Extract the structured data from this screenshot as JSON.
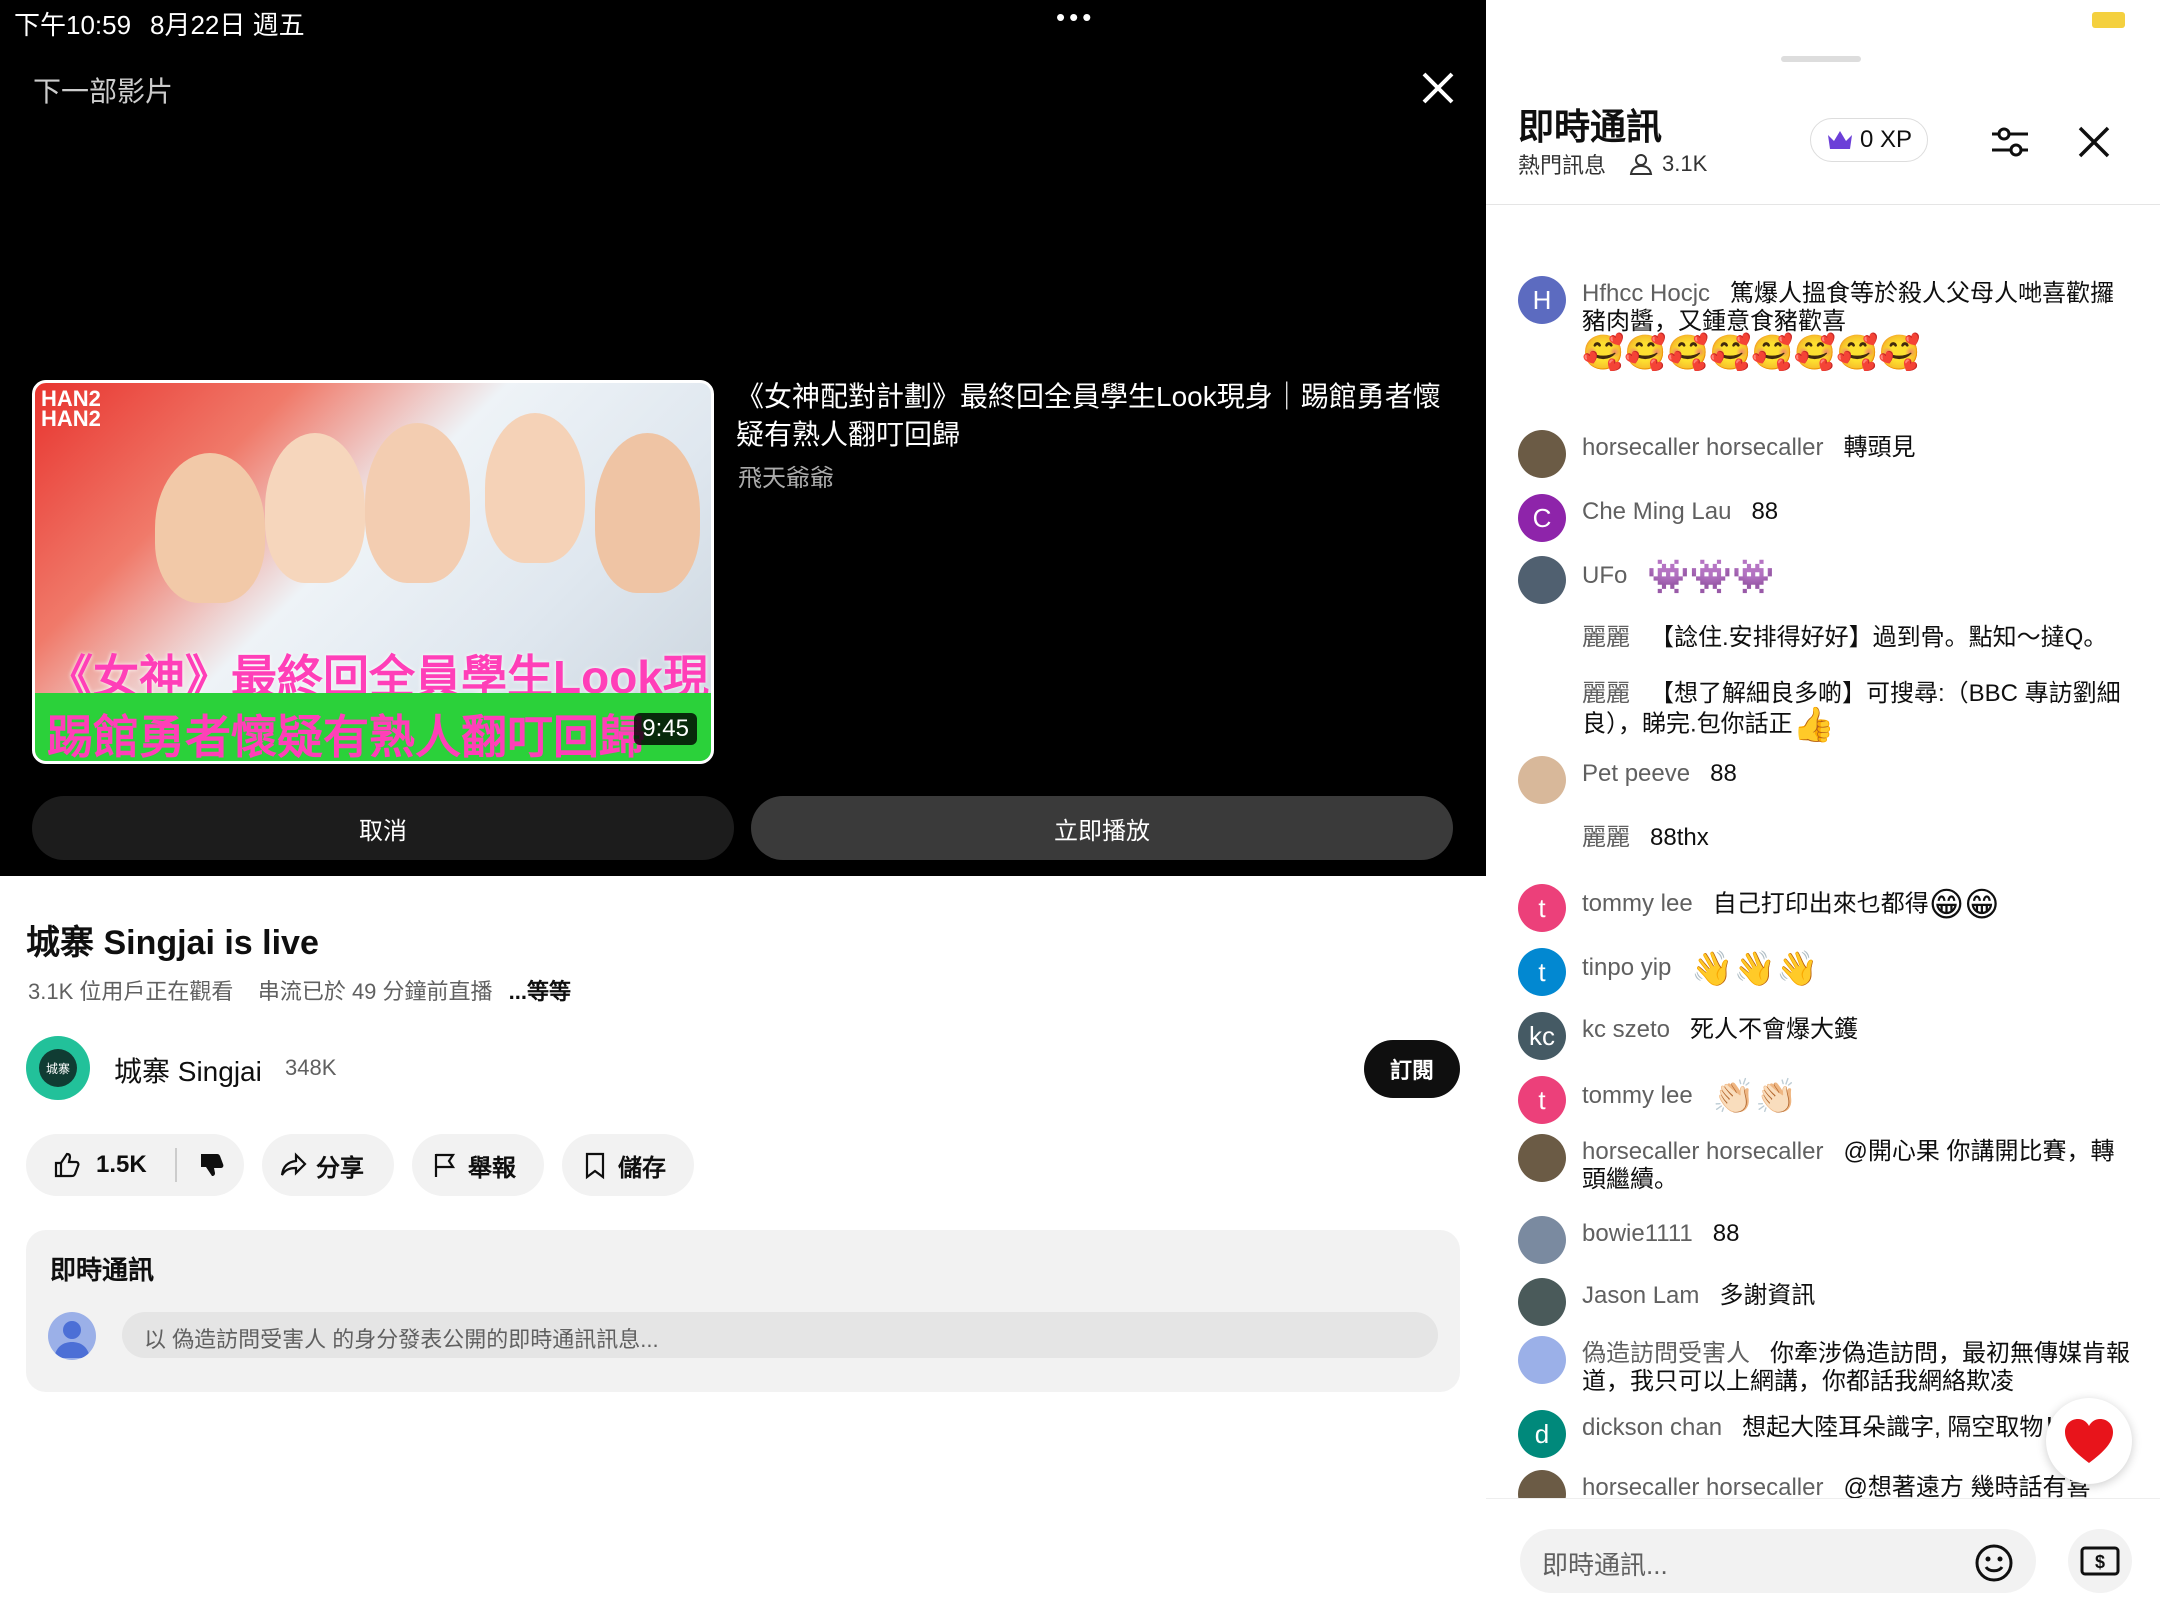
{
  "status": {
    "time": "下午10:59",
    "date": "8月22日 週五",
    "battery": "79%"
  },
  "up_next": {
    "label": "下一部影片",
    "title": "《女神配對計劃》最終回全員學生Look現身｜踢館勇者懷疑有熟人翻叮回歸",
    "channel": "飛天爺爺",
    "duration": "9:45",
    "thumb_line1": "《女神》最終回全員學生Look現身",
    "thumb_line2": "踢館勇者懷疑有熟人翻叮回歸",
    "cancel": "取消",
    "play_now": "立即播放"
  },
  "video": {
    "title": "城寨 Singjai is live",
    "viewers": "3.1K 位用戶正在觀看",
    "started": "串流已於 49 分鐘前直播",
    "more": "...等等",
    "channel_name": "城寨 Singjai",
    "channel_subs": "348K",
    "avatar_text": "城寨",
    "subscribe": "訂閱",
    "likes": "1.5K",
    "share": "分享",
    "report": "舉報",
    "save": "儲存"
  },
  "chat_card": {
    "title": "即時通訊",
    "placeholder": "以 偽造訪問受害人 的身分發表公開的即時通訊訊息..."
  },
  "panel": {
    "title": "即時通訊",
    "mode": "熱門訊息",
    "viewers": "3.1K",
    "xp": "0 XP",
    "input_placeholder": "即時通訊...",
    "messages": [
      {
        "initial": "H",
        "author": "Hfhcc Hocjc",
        "text": "篤爆人搵食等於殺人父母人哋喜歡攞豬肉醬，又鍾意食豬歡喜",
        "emoji": "🥰🥰🥰🥰🥰🥰🥰🥰",
        "color": "#5c6bc0"
      },
      {
        "initial": "",
        "author": "horsecaller horsecaller",
        "text": "轉頭見",
        "emoji": "",
        "color": "#6b5b45"
      },
      {
        "initial": "C",
        "author": "Che Ming Lau",
        "text": "88",
        "emoji": "",
        "color": "#8e24aa"
      },
      {
        "initial": "",
        "author": "UFo",
        "text": "",
        "emoji": "👾👾👾",
        "color": "#506070"
      },
      {
        "initial": "",
        "author": "麗麗",
        "text": "【諗住.安排得好好】過到骨。點知～撻Q。",
        "emoji": "",
        "color": "#ffffff"
      },
      {
        "initial": "",
        "author": "麗麗",
        "text": "【想了解細良多啲】可搜尋:（BBC 專訪劉細良），睇完.包你話正",
        "emoji": "👍",
        "color": "#ffffff"
      },
      {
        "initial": "",
        "author": "Pet peeve",
        "text": "88",
        "emoji": "",
        "color": "#d8b89a"
      },
      {
        "initial": "",
        "author": "麗麗",
        "text": "88thx",
        "emoji": "",
        "color": "#ffffff"
      },
      {
        "initial": "t",
        "author": "tommy lee",
        "text": "自己打印出來乜都得",
        "emoji": "😁😁",
        "color": "#ec407a"
      },
      {
        "initial": "t",
        "author": "tinpo yip",
        "text": "",
        "emoji": "👋👋👋",
        "color": "#0288d1"
      },
      {
        "initial": "kc",
        "author": "kc szeto",
        "text": "死人不會爆大鑊",
        "emoji": "",
        "color": "#455a64"
      },
      {
        "initial": "t",
        "author": "tommy lee",
        "text": "",
        "emoji": "👏🏻👏🏻",
        "color": "#ec407a"
      },
      {
        "initial": "",
        "author": "horsecaller horsecaller",
        "text": "@開心果 你講開比賽，轉頭繼續。",
        "emoji": "",
        "color": "#6b5b45"
      },
      {
        "initial": "",
        "author": "bowie1111",
        "text": "88",
        "emoji": "",
        "color": "#7a8aa0"
      },
      {
        "initial": "",
        "author": "Jason Lam",
        "text": "多謝資訊",
        "emoji": "",
        "color": "#4a5a5a"
      },
      {
        "initial": "",
        "author": "偽造訪問受害人",
        "text": "你牽涉偽造訪問，最初無傳媒肯報道，我只可以上網講，你都話我網絡欺凌",
        "emoji": "",
        "color": "#9bb0e8"
      },
      {
        "initial": "d",
        "author": "dickson chan",
        "text": "想起大陸耳朵識字, 隔空取物！",
        "emoji": "",
        "color": "#00897b"
      },
      {
        "initial": "",
        "author": "horsecaller horsecaller",
        "text": "@想著遠方 幾時話有喜事？",
        "emoji": "🤦🏻‍♂️",
        "color": "#6b5b45"
      }
    ]
  },
  "colors": {
    "accent_red": "#e8141b",
    "crown": "#6c3fd8",
    "play_green": "#2bd13a"
  }
}
